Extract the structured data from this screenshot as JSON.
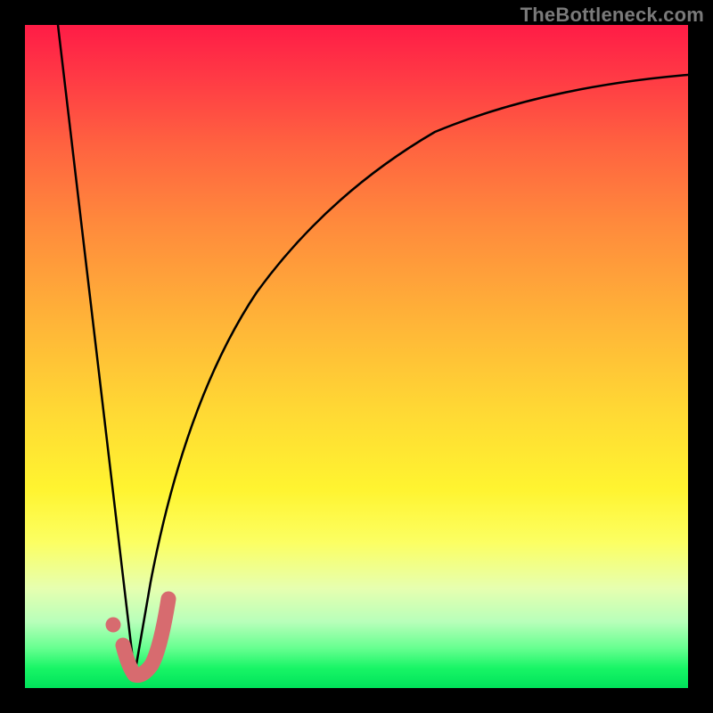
{
  "watermark": "TheBottleneck.com",
  "chart_data": {
    "type": "line",
    "title": "",
    "xlabel": "",
    "ylabel": "",
    "xlim": [
      0,
      100
    ],
    "ylim": [
      0,
      100
    ],
    "grid": false,
    "legend": false,
    "series": [
      {
        "name": "left-descent",
        "color": "#000000",
        "x": [
          5,
          16.5
        ],
        "values": [
          100,
          2
        ]
      },
      {
        "name": "right-curve",
        "color": "#000000",
        "x": [
          16.5,
          19,
          22,
          26,
          30,
          35,
          40,
          46,
          52,
          58,
          66,
          74,
          82,
          90,
          100
        ],
        "values": [
          2,
          16,
          30,
          44,
          55,
          64,
          71,
          77,
          81,
          84,
          87,
          89,
          90.5,
          91.5,
          92.5
        ]
      },
      {
        "name": "highlight-j",
        "color": "#d76b6f",
        "x": [
          14.8,
          15.6,
          16.4,
          17.2,
          18.0,
          19.0,
          20.0,
          20.8,
          21.6
        ],
        "values": [
          6.5,
          3.8,
          2.2,
          2.0,
          2.5,
          4.0,
          6.5,
          9.8,
          13.5
        ]
      },
      {
        "name": "highlight-dot",
        "color": "#d76b6f",
        "x": [
          13.3
        ],
        "values": [
          9.5
        ]
      }
    ]
  }
}
